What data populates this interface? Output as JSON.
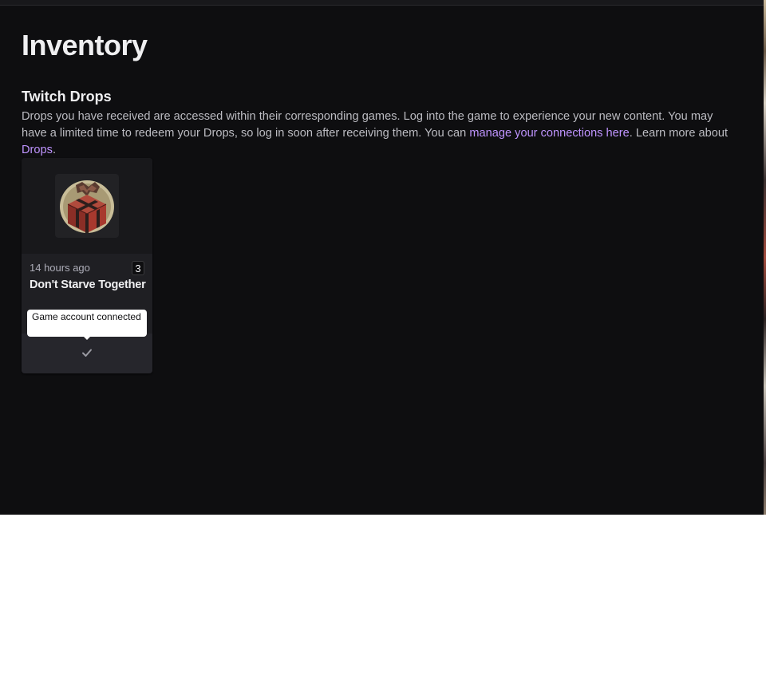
{
  "page": {
    "title": "Inventory"
  },
  "drops_section": {
    "title": "Twitch Drops",
    "description_part1": "Drops you have received are accessed within their corresponding games. Log into the game to experience your new content. You may have a limited time to redeem your Drops, so log in soon after receiving them. You can ",
    "connections_link": "manage your connections here",
    "description_part2": ". Learn more about ",
    "drops_link": "Drops",
    "description_part3": "."
  },
  "drop_card": {
    "image_icon": "gift-box-icon",
    "timestamp": "14 hours ago",
    "count": "3",
    "game_name": "Don't Starve Together",
    "status_icon": "check-icon",
    "tooltip": "Game account connected"
  },
  "colors": {
    "background": "#0e0e10",
    "card": "#1f1f23",
    "link": "#bf94ff",
    "text": "#efeff1"
  }
}
